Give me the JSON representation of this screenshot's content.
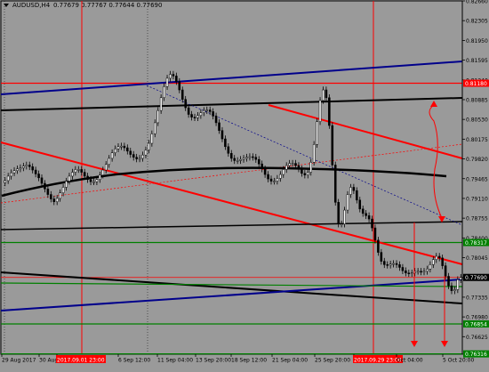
{
  "header": {
    "symbol": "AUDUSD,H4",
    "ohlc": "0.77679 0.77767 0.77644 0.77690"
  },
  "colors": {
    "background": "#9a9a9a",
    "bull": "#ffffff",
    "bear": "#000000",
    "red": "#ff0000",
    "blue": "#00008b",
    "green": "#008000",
    "black": "#000000",
    "axis": "#000000"
  },
  "chart_data": {
    "type": "candlestick",
    "symbol": "AUDUSD",
    "timeframe": "H4",
    "ylim": [
      0.7631,
      0.8266
    ],
    "y_ticks": [
      0.8266,
      0.82305,
      0.8195,
      0.81595,
      0.8124,
      0.80885,
      0.8053,
      0.80175,
      0.7982,
      0.79465,
      0.7911,
      0.78755,
      0.784,
      0.78045,
      0.7769,
      0.77335,
      0.7698,
      0.76625,
      0.7631
    ],
    "y_tick_labels": [
      "0.82660",
      "0.82305",
      "0.81950",
      "0.81595",
      "0.81240",
      "0.80885",
      "0.80530",
      "0.80175",
      "0.79820",
      "0.79465",
      "0.79110",
      "0.78755",
      "0.78400",
      "0.78045",
      "0.77690",
      "0.77335",
      "0.76980",
      "0.76625",
      "0.76310"
    ],
    "x_ticks": [
      "29 Aug 2017",
      "30 Aug",
      "2017.09.01 23:00",
      "6 Sep 12:00",
      "11 Sep 04:00",
      "13 Sep 20:00",
      "18 Sep 12:00",
      "21 Sep 04:00",
      "25 Sep 20:00",
      "2017.09.29 23:00",
      "Oct 04:00",
      "5 Oct 20:00"
    ],
    "price_labels": [
      {
        "value": 0.8118,
        "label": "0.81180",
        "color": "red"
      },
      {
        "value": 0.78317,
        "label": "0.78317",
        "color": "green"
      },
      {
        "value": 0.7769,
        "label": "0.77690",
        "color": "black"
      },
      {
        "value": 0.76854,
        "label": "0.76854",
        "color": "green"
      },
      {
        "value": 0.76316,
        "label": "0.76316",
        "color": "green"
      }
    ],
    "lines": [
      {
        "kind": "horizontal",
        "value": 0.8118,
        "color": "red"
      },
      {
        "kind": "horizontal",
        "value": 0.7769,
        "color": "red",
        "thin": true
      },
      {
        "kind": "horizontal",
        "value": 0.78317,
        "color": "green"
      },
      {
        "kind": "horizontal",
        "value": 0.76854,
        "color": "green"
      },
      {
        "kind": "horizontal",
        "value": 0.76316,
        "color": "green"
      }
    ],
    "close": [
      0.7943,
      0.7951,
      0.7957,
      0.7961,
      0.7964,
      0.7966,
      0.7969,
      0.7971,
      0.7968,
      0.7962,
      0.7955,
      0.7948,
      0.7938,
      0.7928,
      0.7918,
      0.791,
      0.7905,
      0.7911,
      0.7921,
      0.7931,
      0.7942,
      0.7951,
      0.7958,
      0.7963,
      0.7963,
      0.7958,
      0.7951,
      0.7945,
      0.7941,
      0.7941,
      0.7945,
      0.7953,
      0.7962,
      0.7972,
      0.7983,
      0.7993,
      0.8,
      0.8004,
      0.8005,
      0.8002,
      0.7996,
      0.799,
      0.7985,
      0.7982,
      0.7983,
      0.7989,
      0.7998,
      0.801,
      0.8027,
      0.8047,
      0.8069,
      0.8092,
      0.8112,
      0.8127,
      0.8134,
      0.8131,
      0.8121,
      0.8106,
      0.8089,
      0.8074,
      0.8062,
      0.8057,
      0.8056,
      0.806,
      0.8065,
      0.8069,
      0.807,
      0.8067,
      0.8059,
      0.8047,
      0.8033,
      0.8018,
      0.8004,
      0.7992,
      0.7983,
      0.7979,
      0.7979,
      0.7981,
      0.7983,
      0.7985,
      0.7986,
      0.7985,
      0.7981,
      0.7973,
      0.7964,
      0.7954,
      0.7946,
      0.7942,
      0.7942,
      0.7947,
      0.7954,
      0.7963,
      0.797,
      0.7974,
      0.7974,
      0.797,
      0.7964,
      0.7956,
      0.7953,
      0.7958,
      0.7976,
      0.8008,
      0.8049,
      0.8087,
      0.8106,
      0.8092,
      0.8042,
      0.7971,
      0.7904,
      0.7865,
      0.7865,
      0.789,
      0.7918,
      0.7931,
      0.7925,
      0.7908,
      0.7892,
      0.7884,
      0.788,
      0.7874,
      0.7858,
      0.7836,
      0.7814,
      0.7798,
      0.7792,
      0.7791,
      0.7793,
      0.7794,
      0.7792,
      0.7787,
      0.7781,
      0.7777,
      0.7776,
      0.7777,
      0.778,
      0.778,
      0.7779,
      0.778,
      0.7784,
      0.7792,
      0.7801,
      0.7807,
      0.7804,
      0.779,
      0.7771,
      0.7754,
      0.7745,
      0.7747,
      0.7765,
      0.7769
    ]
  }
}
